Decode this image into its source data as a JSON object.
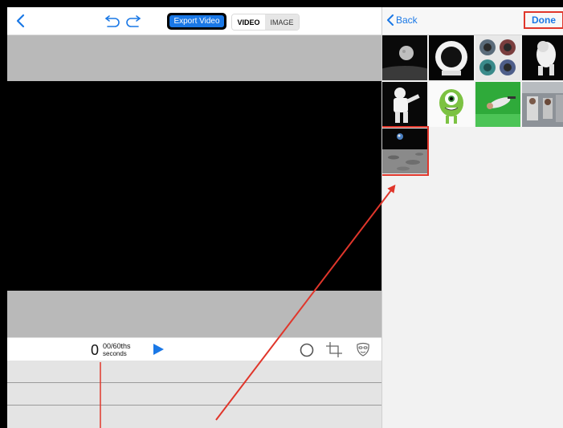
{
  "toolbar": {
    "back_icon": "chevron-left-icon",
    "undo_icon": "undo-icon",
    "redo_icon": "redo-icon",
    "export_label": "Export Video",
    "mode_tabs": [
      {
        "label": "VIDEO",
        "selected": true
      },
      {
        "label": "IMAGE",
        "selected": false
      }
    ]
  },
  "playback": {
    "seconds_value": "0",
    "fraction_label": "00/60ths",
    "seconds_label": "seconds",
    "play_icon": "play-icon",
    "tools": [
      "circle-icon",
      "crop-icon",
      "mask-icon"
    ]
  },
  "picker": {
    "back_label": "Back",
    "done_label": "Done",
    "thumbnails": [
      "moon-in-space",
      "astronaut-helmet-white",
      "helmet-collage",
      "astronaut-floating",
      "astronaut-suit-standing",
      "green-one-eyed-monster",
      "person-on-green-screen",
      "space-station-crew",
      "earthrise-over-moon"
    ],
    "selected_index": 8
  },
  "colors": {
    "accent": "#1a78e6",
    "annotation_red": "#e0362b",
    "preview_gray": "#b9b9b9",
    "timeline_gray": "#e4e4e4"
  }
}
